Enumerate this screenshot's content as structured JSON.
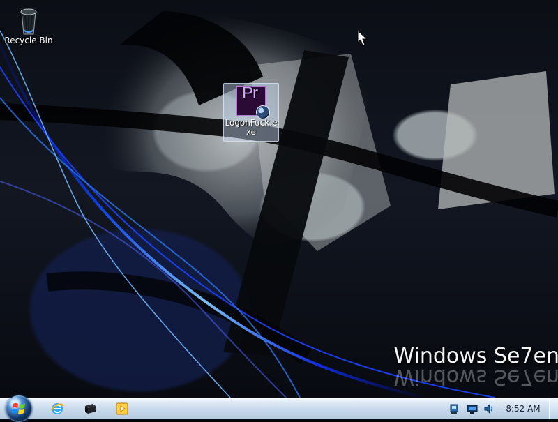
{
  "desktop": {
    "icons": [
      {
        "label": "Recycle Bin",
        "icon": "recycle-bin-icon"
      },
      {
        "label": "LogonFuck.exe",
        "icon": "premiere-pro-icon"
      }
    ],
    "wallpaper_text": "Windows Se7en"
  },
  "taskbar": {
    "pinned": [
      {
        "icon": "internet-explorer-icon"
      },
      {
        "icon": "command-prompt-icon"
      },
      {
        "icon": "media-player-icon"
      }
    ],
    "tray": [
      {
        "icon": "network-icon"
      },
      {
        "icon": "display-icon"
      },
      {
        "icon": "volume-icon"
      }
    ],
    "clock": "8:52 AM"
  }
}
